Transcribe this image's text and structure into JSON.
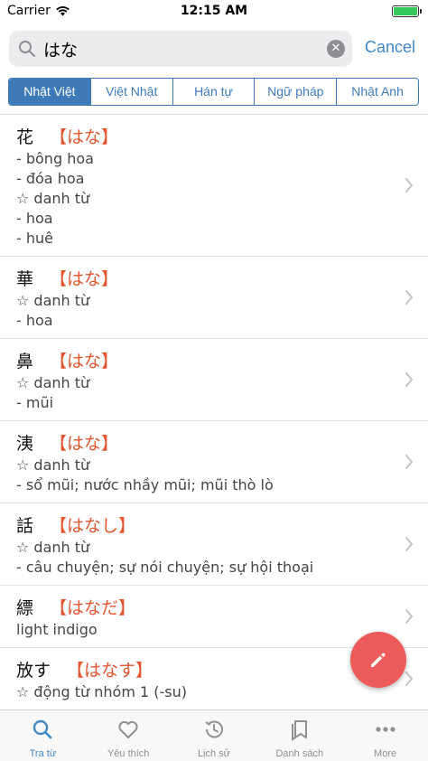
{
  "status_bar": {
    "carrier": "Carrier",
    "time": "12:15 AM",
    "battery_level": 1.0
  },
  "search": {
    "value": "はな",
    "cancel_label": "Cancel"
  },
  "tabs": [
    {
      "label": "Nhật Việt",
      "active": true
    },
    {
      "label": "Việt Nhật",
      "active": false
    },
    {
      "label": "Hán tự",
      "active": false
    },
    {
      "label": "Ngữ pháp",
      "active": false
    },
    {
      "label": "Nhật Anh",
      "active": false
    }
  ],
  "results": [
    {
      "kanji": "花",
      "kana": "【はな】",
      "lines": [
        "- bông hoa",
        "- đóa hoa",
        "☆ danh từ",
        "- hoa",
        "- huê"
      ]
    },
    {
      "kanji": "華",
      "kana": "【はな】",
      "lines": [
        "☆ danh từ",
        "- hoa"
      ]
    },
    {
      "kanji": "鼻",
      "kana": "【はな】",
      "lines": [
        "☆ danh từ",
        "- mũi"
      ]
    },
    {
      "kanji": "洟",
      "kana": "【はな】",
      "lines": [
        "☆ danh từ",
        "- sổ mũi; nước nhầy mũi; mũi thò lò"
      ]
    },
    {
      "kanji": "話",
      "kana": "【はなし】",
      "lines": [
        "☆ danh từ",
        "- câu chuyện; sự nói chuyện; sự hội thoại"
      ]
    },
    {
      "kanji": "縹",
      "kana": "【はなだ】",
      "lines": [
        "light indigo"
      ]
    },
    {
      "kanji": "放す",
      "kana": "【はなす】",
      "lines": [
        "☆ động từ nhóm 1 (-su)"
      ]
    }
  ],
  "tabbar": [
    {
      "label": "Tra từ",
      "icon": "search-icon",
      "active": true
    },
    {
      "label": "Yêu thích",
      "icon": "heart-icon",
      "active": false
    },
    {
      "label": "Lịch sử",
      "icon": "history-icon",
      "active": false
    },
    {
      "label": "Danh sách",
      "icon": "bookmarks-icon",
      "active": false
    },
    {
      "label": "More",
      "icon": "more-icon",
      "active": false
    }
  ],
  "colors": {
    "accent": "#3f88c5",
    "kana": "#e2552f",
    "fab": "#ec5a5a"
  }
}
